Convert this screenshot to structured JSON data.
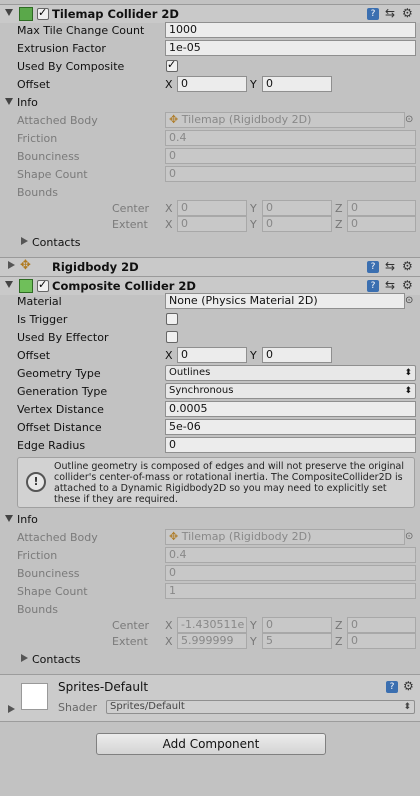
{
  "tilemap_collider": {
    "title": "Tilemap Collider 2D",
    "enabled": true,
    "max_tile_change_count": {
      "label": "Max Tile Change Count",
      "value": "1000"
    },
    "extrusion_factor": {
      "label": "Extrusion Factor",
      "value": "1e-05"
    },
    "used_by_composite": {
      "label": "Used By Composite",
      "checked": true
    },
    "offset": {
      "label": "Offset",
      "x_label": "X",
      "x": "0",
      "y_label": "Y",
      "y": "0"
    },
    "info": {
      "label": "Info",
      "attached_body": {
        "label": "Attached Body",
        "value": "Tilemap (Rigidbody 2D)"
      },
      "friction": {
        "label": "Friction",
        "value": "0.4"
      },
      "bounciness": {
        "label": "Bounciness",
        "value": "0"
      },
      "shape_count": {
        "label": "Shape Count",
        "value": "0"
      },
      "bounds": {
        "label": "Bounds"
      },
      "center": {
        "label": "Center",
        "x_label": "X",
        "x": "0",
        "y_label": "Y",
        "y": "0",
        "z_label": "Z",
        "z": "0"
      },
      "extent": {
        "label": "Extent",
        "x_label": "X",
        "x": "0",
        "y_label": "Y",
        "y": "0",
        "z_label": "Z",
        "z": "0"
      },
      "contacts": {
        "label": "Contacts"
      }
    }
  },
  "rigidbody": {
    "title": "Rigidbody 2D"
  },
  "composite_collider": {
    "title": "Composite Collider 2D",
    "material": {
      "label": "Material",
      "value": "None (Physics Material 2D)"
    },
    "is_trigger": {
      "label": "Is Trigger",
      "checked": false
    },
    "used_by_effector": {
      "label": "Used By Effector",
      "checked": false
    },
    "offset": {
      "label": "Offset",
      "x_label": "X",
      "x": "0",
      "y_label": "Y",
      "y": "0"
    },
    "geometry_type": {
      "label": "Geometry Type",
      "value": "Outlines"
    },
    "generation_type": {
      "label": "Generation Type",
      "value": "Synchronous"
    },
    "vertex_distance": {
      "label": "Vertex Distance",
      "value": "0.0005"
    },
    "offset_distance": {
      "label": "Offset Distance",
      "value": "5e-06"
    },
    "edge_radius": {
      "label": "Edge Radius",
      "value": "0"
    },
    "help_text": "Outline geometry is composed of edges and will not preserve the original collider's center-of-mass or rotational inertia.  The CompositeCollider2D is attached to a Dynamic Rigidbody2D so you may need to explicitly set these if they are required.",
    "info": {
      "label": "Info",
      "attached_body": {
        "label": "Attached Body",
        "value": "Tilemap (Rigidbody 2D)"
      },
      "friction": {
        "label": "Friction",
        "value": "0.4"
      },
      "bounciness": {
        "label": "Bounciness",
        "value": "0"
      },
      "shape_count": {
        "label": "Shape Count",
        "value": "1"
      },
      "bounds": {
        "label": "Bounds"
      },
      "center": {
        "label": "Center",
        "x_label": "X",
        "x": "-1.430511e",
        "y_label": "Y",
        "y": "0",
        "z_label": "Z",
        "z": "0"
      },
      "extent": {
        "label": "Extent",
        "x_label": "X",
        "x": "5.999999",
        "y_label": "Y",
        "y": "5",
        "z_label": "Z",
        "z": "0"
      },
      "contacts": {
        "label": "Contacts"
      }
    }
  },
  "material_asset": {
    "name": "Sprites-Default",
    "shader_label": "Shader",
    "shader_value": "Sprites/Default"
  },
  "add_component_label": "Add Component"
}
